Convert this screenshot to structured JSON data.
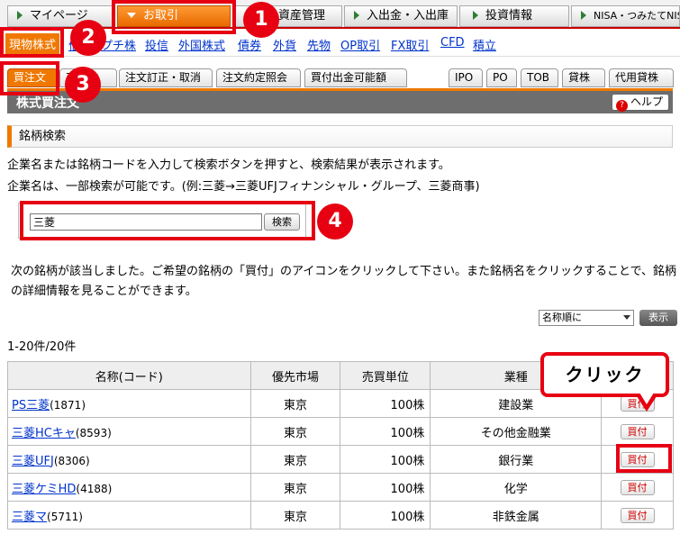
{
  "topnav": {
    "items": [
      "マイページ",
      "お取引",
      "資産管理",
      "入出金・入出庫",
      "投資情報",
      "NISA・つみたてNISA"
    ]
  },
  "subnav": {
    "items": [
      "現物株式",
      "信用",
      "プチ株",
      "投信",
      "外国株式",
      "債券",
      "外貨",
      "先物",
      "OP取引",
      "FX取引",
      "CFD",
      "積立"
    ]
  },
  "tabs": {
    "left": [
      "買注文",
      "売注文",
      "注文訂正・取消",
      "注文約定照会",
      "買付出金可能額"
    ],
    "right": [
      "IPO",
      "PO",
      "TOB",
      "貸株",
      "代用貸株"
    ]
  },
  "title": "株式買注文",
  "help_label": "ヘルプ",
  "section_title": "銘柄検索",
  "desc1": "企業名または銘柄コードを入力して検索ボタンを押すと、検索結果が表示されます。",
  "desc2": "企業名は、一部検索が可能です。(例:三菱→三菱UFJフィナンシャル・グループ、三菱商事)",
  "search": {
    "value": "三菱",
    "button": "検索"
  },
  "result_msg": "次の銘柄が該当しました。ご希望の銘柄の「買付」のアイコンをクリックして下さい。また銘柄名をクリックすることで、銘柄の詳細情報を見ることができます。",
  "sort": {
    "selected": "名称順に",
    "button": "表示"
  },
  "count": "1-20件/20件",
  "table": {
    "headers": [
      "名称(コード)",
      "優先市場",
      "売買単位",
      "業種",
      ""
    ],
    "rows": [
      {
        "name": "PS三菱",
        "code": "(1871)",
        "market": "東京",
        "unit": "100株",
        "industry": "建設業",
        "buy": "買付"
      },
      {
        "name": "三菱HCキャ",
        "code": "(8593)",
        "market": "東京",
        "unit": "100株",
        "industry": "その他金融業",
        "buy": "買付"
      },
      {
        "name": "三菱UFJ",
        "code": "(8306)",
        "market": "東京",
        "unit": "100株",
        "industry": "銀行業",
        "buy": "買付"
      },
      {
        "name": "三菱ケミHD",
        "code": "(4188)",
        "market": "東京",
        "unit": "100株",
        "industry": "化学",
        "buy": "買付"
      },
      {
        "name": "三菱マ",
        "code": "(5711)",
        "market": "東京",
        "unit": "100株",
        "industry": "非鉄金属",
        "buy": "買付"
      }
    ]
  },
  "annotations": {
    "numbers": [
      "1",
      "2",
      "3",
      "4"
    ],
    "callout": "クリック"
  }
}
